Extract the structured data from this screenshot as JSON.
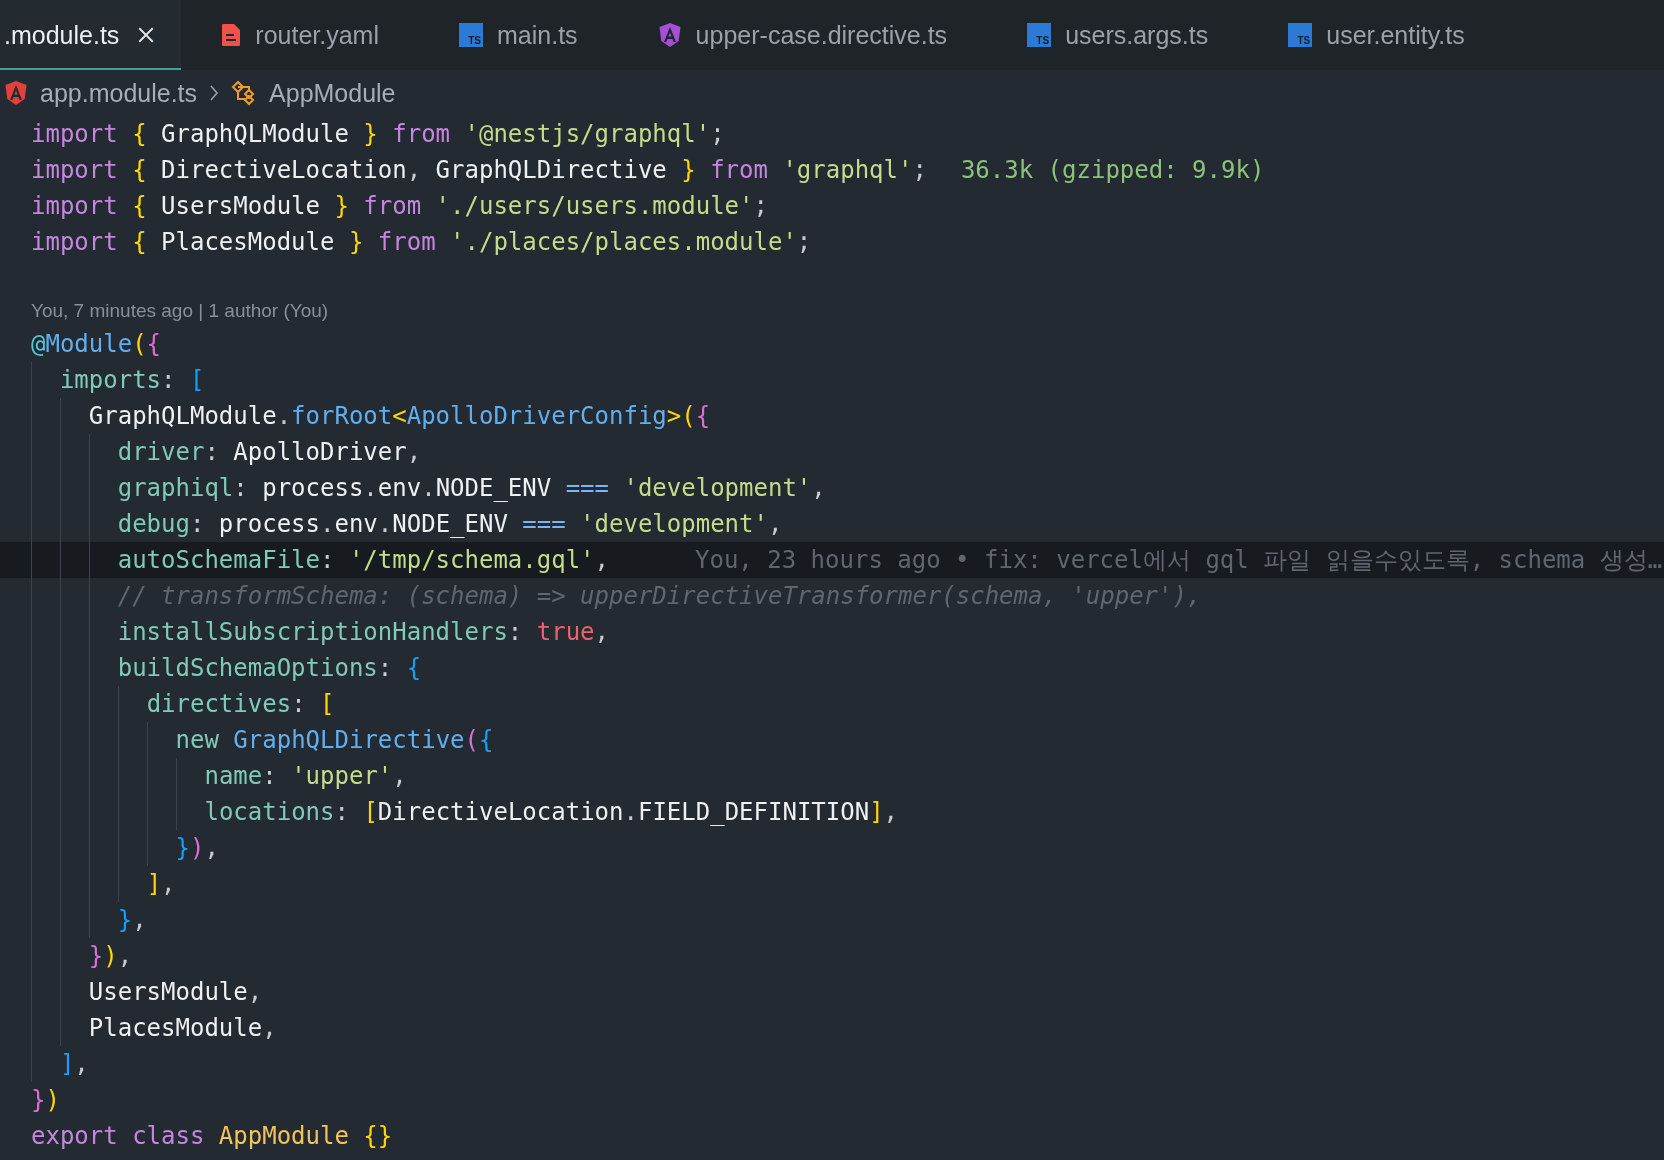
{
  "tabs": [
    {
      "label": ".module.ts",
      "selected": true
    },
    {
      "label": "router.yaml",
      "kind": "yaml",
      "selected": false
    },
    {
      "label": "main.ts",
      "kind": "ts",
      "icon_label": "TS",
      "selected": false
    },
    {
      "label": "upper-case.directive.ts",
      "kind": "angular",
      "color": "#a64fd6",
      "selected": false
    },
    {
      "label": "users.args.ts",
      "kind": "ts",
      "icon_label": "TS",
      "selected": false
    },
    {
      "label": "user.entity.ts",
      "kind": "ts",
      "icon_label": "TS",
      "selected": false
    }
  ],
  "breadcrumb": [
    {
      "label": "app.module.ts",
      "kind": "angular",
      "color": "#e2403a"
    },
    {
      "label": "AppModule",
      "kind": "class"
    }
  ],
  "editor": {
    "lines": [
      {
        "kind": "code",
        "current": false,
        "tokens": [
          {
            "text": "import",
            "kind": "kw"
          },
          {
            "text": " {",
            "kind": "b1"
          },
          {
            "text": " GraphQLModule",
            "kind": "id"
          },
          {
            "text": " }",
            "kind": "b1"
          },
          {
            "text": " from",
            "kind": "kw"
          },
          {
            "text": " '@nestjs/graphql'",
            "kind": "s"
          },
          {
            "text": ";",
            "kind": "p"
          }
        ]
      },
      {
        "kind": "code",
        "current": false,
        "tokens": [
          {
            "text": "import",
            "kind": "kw"
          },
          {
            "text": " {",
            "kind": "b1"
          },
          {
            "text": " DirectiveLocation",
            "kind": "id"
          },
          {
            "text": ",",
            "kind": "p"
          },
          {
            "text": " GraphQLDirective",
            "kind": "id"
          },
          {
            "text": " }",
            "kind": "b1"
          },
          {
            "text": " from",
            "kind": "kw"
          },
          {
            "text": " 'graphql'",
            "kind": "s"
          },
          {
            "text": ";",
            "kind": "p"
          }
        ],
        "annotation": {
          "kind": "size",
          "text": "36.3k (gzipped: 9.9k)"
        }
      },
      {
        "kind": "code",
        "current": false,
        "tokens": [
          {
            "text": "import",
            "kind": "kw"
          },
          {
            "text": " {",
            "kind": "b1"
          },
          {
            "text": " UsersModule",
            "kind": "id"
          },
          {
            "text": " }",
            "kind": "b1"
          },
          {
            "text": " from",
            "kind": "kw"
          },
          {
            "text": " './users/users.module'",
            "kind": "s"
          },
          {
            "text": ";",
            "kind": "p"
          }
        ]
      },
      {
        "kind": "code",
        "current": false,
        "tokens": [
          {
            "text": "import",
            "kind": "kw"
          },
          {
            "text": " {",
            "kind": "b1"
          },
          {
            "text": " PlacesModule",
            "kind": "id"
          },
          {
            "text": " }",
            "kind": "b1"
          },
          {
            "text": " from",
            "kind": "kw"
          },
          {
            "text": " './places/places.module'",
            "kind": "s"
          },
          {
            "text": ";",
            "kind": "p"
          }
        ]
      },
      {
        "kind": "blank"
      },
      {
        "kind": "codelens",
        "text": "You, 7 minutes ago | 1 author (You)"
      },
      {
        "kind": "code",
        "current": false,
        "tokens": [
          {
            "text": "@",
            "kind": "dec"
          },
          {
            "text": "Module",
            "kind": "fn"
          },
          {
            "text": "(",
            "kind": "b1"
          },
          {
            "text": "{",
            "kind": "b2"
          }
        ]
      },
      {
        "kind": "code",
        "current": false,
        "tokens": [
          {
            "text": "  imports",
            "kind": "prop"
          },
          {
            "text": ":",
            "kind": "p"
          },
          {
            "text": " [",
            "kind": "b3"
          }
        ]
      },
      {
        "kind": "code",
        "current": false,
        "tokens": [
          {
            "text": "    GraphQLModule",
            "kind": "id"
          },
          {
            "text": ".",
            "kind": "p"
          },
          {
            "text": "forRoot",
            "kind": "fn"
          },
          {
            "text": "<",
            "kind": "b1"
          },
          {
            "text": "ApolloDriverConfig",
            "kind": "fn"
          },
          {
            "text": ">",
            "kind": "b1"
          },
          {
            "text": "(",
            "kind": "b1"
          },
          {
            "text": "{",
            "kind": "b2"
          }
        ]
      },
      {
        "kind": "code",
        "current": false,
        "tokens": [
          {
            "text": "      driver",
            "kind": "prop"
          },
          {
            "text": ":",
            "kind": "p"
          },
          {
            "text": " ApolloDriver",
            "kind": "id"
          },
          {
            "text": ",",
            "kind": "p"
          }
        ]
      },
      {
        "kind": "code",
        "current": false,
        "tokens": [
          {
            "text": "      graphiql",
            "kind": "prop"
          },
          {
            "text": ":",
            "kind": "p"
          },
          {
            "text": " process",
            "kind": "id"
          },
          {
            "text": ".",
            "kind": "p"
          },
          {
            "text": "env",
            "kind": "id"
          },
          {
            "text": ".",
            "kind": "p"
          },
          {
            "text": "NODE_ENV",
            "kind": "id"
          },
          {
            "text": " ===",
            "kind": "op"
          },
          {
            "text": " 'development'",
            "kind": "s"
          },
          {
            "text": ",",
            "kind": "p"
          }
        ]
      },
      {
        "kind": "code",
        "current": false,
        "tokens": [
          {
            "text": "      debug",
            "kind": "prop"
          },
          {
            "text": ":",
            "kind": "p"
          },
          {
            "text": " process",
            "kind": "id"
          },
          {
            "text": ".",
            "kind": "p"
          },
          {
            "text": "env",
            "kind": "id"
          },
          {
            "text": ".",
            "kind": "p"
          },
          {
            "text": "NODE_ENV",
            "kind": "id"
          },
          {
            "text": " ===",
            "kind": "op"
          },
          {
            "text": " 'development'",
            "kind": "s"
          },
          {
            "text": ",",
            "kind": "p"
          }
        ]
      },
      {
        "kind": "code",
        "current": true,
        "tokens": [
          {
            "text": "      autoSchemaFile",
            "kind": "prop"
          },
          {
            "text": ":",
            "kind": "p"
          },
          {
            "text": " '/tmp/schema.gql'",
            "kind": "s"
          },
          {
            "text": ",",
            "kind": "p"
          }
        ],
        "annotation": {
          "kind": "blame",
          "text": "You, 23 hours ago • fix: vercel에서 gql 파일 읽을수있도록, schema 생성…"
        }
      },
      {
        "kind": "code",
        "current": false,
        "tokens": [
          {
            "text": "      // transformSchema: (schema) => upperDirectiveTransformer(schema, 'upper'),",
            "kind": "cmt"
          }
        ]
      },
      {
        "kind": "code",
        "current": false,
        "tokens": [
          {
            "text": "      installSubscriptionHandlers",
            "kind": "prop"
          },
          {
            "text": ":",
            "kind": "p"
          },
          {
            "text": " true",
            "kind": "bool"
          },
          {
            "text": ",",
            "kind": "p"
          }
        ]
      },
      {
        "kind": "code",
        "current": false,
        "tokens": [
          {
            "text": "      buildSchemaOptions",
            "kind": "prop"
          },
          {
            "text": ":",
            "kind": "p"
          },
          {
            "text": " {",
            "kind": "b3"
          }
        ]
      },
      {
        "kind": "code",
        "current": false,
        "tokens": [
          {
            "text": "        directives",
            "kind": "prop"
          },
          {
            "text": ":",
            "kind": "p"
          },
          {
            "text": " [",
            "kind": "b1"
          }
        ]
      },
      {
        "kind": "code",
        "current": false,
        "tokens": [
          {
            "text": "          new",
            "kind": "prop"
          },
          {
            "text": " GraphQLDirective",
            "kind": "fn"
          },
          {
            "text": "(",
            "kind": "b2"
          },
          {
            "text": "{",
            "kind": "b3"
          }
        ]
      },
      {
        "kind": "code",
        "current": false,
        "tokens": [
          {
            "text": "            name",
            "kind": "prop"
          },
          {
            "text": ":",
            "kind": "p"
          },
          {
            "text": " 'upper'",
            "kind": "s"
          },
          {
            "text": ",",
            "kind": "p"
          }
        ]
      },
      {
        "kind": "code",
        "current": false,
        "tokens": [
          {
            "text": "            locations",
            "kind": "prop"
          },
          {
            "text": ":",
            "kind": "p"
          },
          {
            "text": " [",
            "kind": "b1"
          },
          {
            "text": "DirectiveLocation",
            "kind": "id"
          },
          {
            "text": ".",
            "kind": "p"
          },
          {
            "text": "FIELD_DEFINITION",
            "kind": "id"
          },
          {
            "text": "]",
            "kind": "b1"
          },
          {
            "text": ",",
            "kind": "p"
          }
        ]
      },
      {
        "kind": "code",
        "current": false,
        "tokens": [
          {
            "text": "          }",
            "kind": "b3"
          },
          {
            "text": ")",
            "kind": "b2"
          },
          {
            "text": ",",
            "kind": "p"
          }
        ]
      },
      {
        "kind": "code",
        "current": false,
        "tokens": [
          {
            "text": "        ]",
            "kind": "b1"
          },
          {
            "text": ",",
            "kind": "p"
          }
        ]
      },
      {
        "kind": "code",
        "current": false,
        "tokens": [
          {
            "text": "      }",
            "kind": "b3"
          },
          {
            "text": ",",
            "kind": "p"
          }
        ]
      },
      {
        "kind": "code",
        "current": false,
        "tokens": [
          {
            "text": "    }",
            "kind": "b2"
          },
          {
            "text": ")",
            "kind": "b1"
          },
          {
            "text": ",",
            "kind": "p"
          }
        ]
      },
      {
        "kind": "code",
        "current": false,
        "tokens": [
          {
            "text": "    UsersModule",
            "kind": "id"
          },
          {
            "text": ",",
            "kind": "p"
          }
        ]
      },
      {
        "kind": "code",
        "current": false,
        "tokens": [
          {
            "text": "    PlacesModule",
            "kind": "id"
          },
          {
            "text": ",",
            "kind": "p"
          }
        ]
      },
      {
        "kind": "code",
        "current": false,
        "tokens": [
          {
            "text": "  ]",
            "kind": "b3"
          },
          {
            "text": ",",
            "kind": "p"
          }
        ]
      },
      {
        "kind": "code",
        "current": false,
        "tokens": [
          {
            "text": "}",
            "kind": "b2"
          },
          {
            "text": ")",
            "kind": "b1"
          }
        ]
      },
      {
        "kind": "code",
        "current": false,
        "tokens": [
          {
            "text": "export",
            "kind": "kw"
          },
          {
            "text": " class",
            "kind": "kw"
          },
          {
            "text": " AppModule",
            "kind": "cls"
          },
          {
            "text": " {}",
            "kind": "b1"
          }
        ]
      }
    ]
  }
}
